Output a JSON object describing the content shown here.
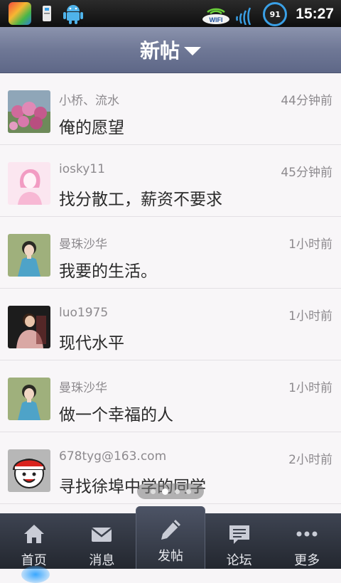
{
  "status_bar": {
    "time": "15:27",
    "battery": "91",
    "wifi_label": "WIFI"
  },
  "header": {
    "title": "新帖"
  },
  "posts": [
    {
      "author": "小桥、流水",
      "time": "44分钟前",
      "message": "俺的愿望",
      "avatar": "flowers-photo"
    },
    {
      "author": "iosky11",
      "time": "45分钟前",
      "message": "找分散工，薪资不要求",
      "avatar": "pink-girl-silhouette"
    },
    {
      "author": "曼珠沙华",
      "time": "1小时前",
      "message": "我要的生活。",
      "avatar": "girl-blue-dress-photo"
    },
    {
      "author": "luo1975",
      "time": "1小时前",
      "message": "现代水平",
      "avatar": "man-portrait-photo"
    },
    {
      "author": "曼珠沙华",
      "time": "1小时前",
      "message": "做一个幸福的人",
      "avatar": "girl-blue-dress-photo"
    },
    {
      "author": "678tyg@163.com",
      "time": "2小时前",
      "message": "寻找徐埠中学的同学",
      "avatar": "cartoon-face-red-hat"
    }
  ],
  "pager": {
    "count": 4,
    "active": 1
  },
  "nav": {
    "items": [
      {
        "label": "首页",
        "icon": "home-icon"
      },
      {
        "label": "消息",
        "icon": "mail-icon"
      },
      {
        "label": "发帖",
        "icon": "pencil-icon"
      },
      {
        "label": "论坛",
        "icon": "chat-icon"
      },
      {
        "label": "更多",
        "icon": "more-icon"
      }
    ],
    "active_index": 2
  },
  "colors": {
    "header": "#6f7896",
    "nav": "#2d323c",
    "accent": "#3aa0e6"
  }
}
